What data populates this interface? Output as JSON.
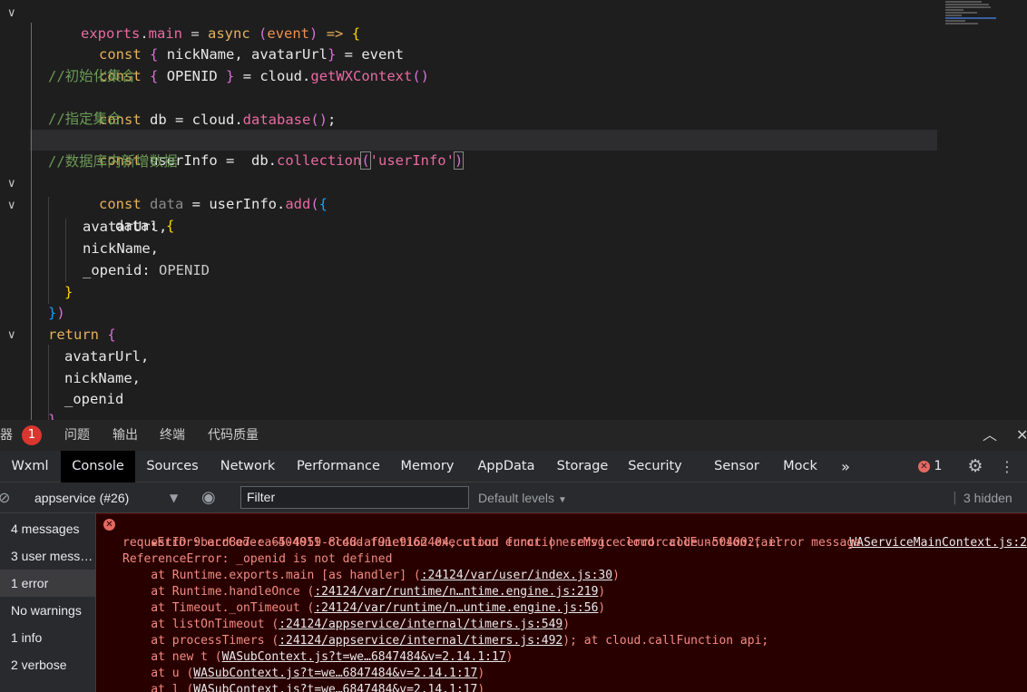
{
  "editor": {
    "lines": [
      "exports.main = async (event) => {",
      "  const { nickName, avatarUrl} = event",
      "  const { OPENID } = cloud.getWXContext()",
      "  //初始化集合",
      "  const db = cloud.database();",
      "  //指定集合",
      "  const userInfo =  db.collection('userInfo')",
      "  //数据库内新增数据",
      "  const data = userInfo.add({",
      "    data: {",
      "      avatarUrl,",
      "      nickName,",
      "      _openid: OPENID",
      "    }",
      "  })",
      "  return {",
      "    avatarUrl,",
      "    nickName,",
      "    _openid",
      "  }"
    ],
    "fold_icon": "chevron-down-icon"
  },
  "panel": {
    "left_cut_label": "器",
    "badge_count": "1",
    "tabs": [
      "问题",
      "输出",
      "终端",
      "代码质量"
    ]
  },
  "devtools": {
    "tabs": [
      "Wxml",
      "Console",
      "Sources",
      "Network",
      "Performance",
      "Memory",
      "AppData",
      "Storage",
      "Security",
      "Sensor",
      "Mock"
    ],
    "active_tab": "Console",
    "more_icon": "»",
    "error_count": "1"
  },
  "console_toolbar": {
    "context": "appservice (#26)",
    "filter_placeholder": "Filter",
    "levels": "Default levels",
    "hidden": "3 hidden"
  },
  "sidebar": {
    "items": [
      "4 messages",
      "3 user mess…",
      "1 error",
      "No warnings",
      "1 info",
      "2 verbose"
    ],
    "active_index": 2
  },
  "console": {
    "error_head": "Error: errCode: -404011 cloud function execution error | errMsg: cloud.callFunction:fail",
    "error_source": "WAServiceMainContext.js:2",
    "line2": "requestID 9bacd8e7-ea65-4959-8c48-af91e9162404, cloud function service error code -504002, error message",
    "line3": "ReferenceError: _openid is not defined",
    "stack": [
      {
        "prefix": "    at Runtime.exports.main [as handler] (",
        "link": ":24124/var/user/index.js:30",
        "suffix": ")"
      },
      {
        "prefix": "    at Runtime.handleOnce (",
        "link": ":24124/var/runtime/n…ntime.engine.js:219",
        "suffix": ")"
      },
      {
        "prefix": "    at Timeout._onTimeout (",
        "link": ":24124/var/runtime/n…untime.engine.js:56",
        "suffix": ")"
      },
      {
        "prefix": "    at listOnTimeout (",
        "link": ":24124/appservice/internal/timers.js:549",
        "suffix": ")"
      },
      {
        "prefix": "    at processTimers (",
        "link": ":24124/appservice/internal/timers.js:492",
        "suffix": "); at cloud.callFunction api;"
      },
      {
        "prefix": "    at new t (",
        "link": "WASubContext.js?t=we…6847484&v=2.14.1:17",
        "suffix": ")"
      },
      {
        "prefix": "    at u (",
        "link": "WASubContext.js?t=we…6847484&v=2.14.1:17",
        "suffix": ")"
      },
      {
        "prefix": "    at l (",
        "link": "WASubContext.js?t=we…6847484&v=2.14.1:17",
        "suffix": ")"
      }
    ]
  },
  "colors": {
    "error_text": "#f28b82",
    "error_bg": "#290000",
    "badge_red": "#d9362f"
  }
}
